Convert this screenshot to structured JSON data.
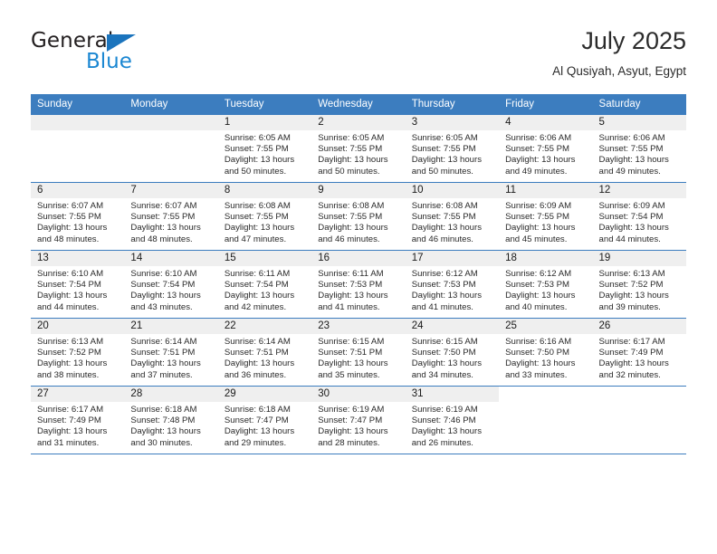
{
  "brand": {
    "name_top": "General",
    "name_bottom": "Blue",
    "triangle_color": "#1b74bd",
    "blue_text_color": "#1b87d2"
  },
  "header": {
    "title": "July 2025",
    "subtitle": "Al Qusiyah, Asyut, Egypt"
  },
  "theme": {
    "header_bg": "#3c7dbf",
    "header_text": "#ffffff",
    "daynum_band_bg": "#efefef",
    "grid_line": "#3c7dbf",
    "body_text": "#2a2a2a"
  },
  "weekdays": [
    "Sunday",
    "Monday",
    "Tuesday",
    "Wednesday",
    "Thursday",
    "Friday",
    "Saturday"
  ],
  "weeks": [
    [
      {
        "day": "",
        "empty": true,
        "sunrise": "",
        "sunset": "",
        "daylight_line1": "",
        "daylight_line2": ""
      },
      {
        "day": "",
        "empty": true,
        "sunrise": "",
        "sunset": "",
        "daylight_line1": "",
        "daylight_line2": ""
      },
      {
        "day": "1",
        "sunrise": "Sunrise: 6:05 AM",
        "sunset": "Sunset: 7:55 PM",
        "daylight_line1": "Daylight: 13 hours",
        "daylight_line2": "and 50 minutes."
      },
      {
        "day": "2",
        "sunrise": "Sunrise: 6:05 AM",
        "sunset": "Sunset: 7:55 PM",
        "daylight_line1": "Daylight: 13 hours",
        "daylight_line2": "and 50 minutes."
      },
      {
        "day": "3",
        "sunrise": "Sunrise: 6:05 AM",
        "sunset": "Sunset: 7:55 PM",
        "daylight_line1": "Daylight: 13 hours",
        "daylight_line2": "and 50 minutes."
      },
      {
        "day": "4",
        "sunrise": "Sunrise: 6:06 AM",
        "sunset": "Sunset: 7:55 PM",
        "daylight_line1": "Daylight: 13 hours",
        "daylight_line2": "and 49 minutes."
      },
      {
        "day": "5",
        "sunrise": "Sunrise: 6:06 AM",
        "sunset": "Sunset: 7:55 PM",
        "daylight_line1": "Daylight: 13 hours",
        "daylight_line2": "and 49 minutes."
      }
    ],
    [
      {
        "day": "6",
        "sunrise": "Sunrise: 6:07 AM",
        "sunset": "Sunset: 7:55 PM",
        "daylight_line1": "Daylight: 13 hours",
        "daylight_line2": "and 48 minutes."
      },
      {
        "day": "7",
        "sunrise": "Sunrise: 6:07 AM",
        "sunset": "Sunset: 7:55 PM",
        "daylight_line1": "Daylight: 13 hours",
        "daylight_line2": "and 48 minutes."
      },
      {
        "day": "8",
        "sunrise": "Sunrise: 6:08 AM",
        "sunset": "Sunset: 7:55 PM",
        "daylight_line1": "Daylight: 13 hours",
        "daylight_line2": "and 47 minutes."
      },
      {
        "day": "9",
        "sunrise": "Sunrise: 6:08 AM",
        "sunset": "Sunset: 7:55 PM",
        "daylight_line1": "Daylight: 13 hours",
        "daylight_line2": "and 46 minutes."
      },
      {
        "day": "10",
        "sunrise": "Sunrise: 6:08 AM",
        "sunset": "Sunset: 7:55 PM",
        "daylight_line1": "Daylight: 13 hours",
        "daylight_line2": "and 46 minutes."
      },
      {
        "day": "11",
        "sunrise": "Sunrise: 6:09 AM",
        "sunset": "Sunset: 7:55 PM",
        "daylight_line1": "Daylight: 13 hours",
        "daylight_line2": "and 45 minutes."
      },
      {
        "day": "12",
        "sunrise": "Sunrise: 6:09 AM",
        "sunset": "Sunset: 7:54 PM",
        "daylight_line1": "Daylight: 13 hours",
        "daylight_line2": "and 44 minutes."
      }
    ],
    [
      {
        "day": "13",
        "sunrise": "Sunrise: 6:10 AM",
        "sunset": "Sunset: 7:54 PM",
        "daylight_line1": "Daylight: 13 hours",
        "daylight_line2": "and 44 minutes."
      },
      {
        "day": "14",
        "sunrise": "Sunrise: 6:10 AM",
        "sunset": "Sunset: 7:54 PM",
        "daylight_line1": "Daylight: 13 hours",
        "daylight_line2": "and 43 minutes."
      },
      {
        "day": "15",
        "sunrise": "Sunrise: 6:11 AM",
        "sunset": "Sunset: 7:54 PM",
        "daylight_line1": "Daylight: 13 hours",
        "daylight_line2": "and 42 minutes."
      },
      {
        "day": "16",
        "sunrise": "Sunrise: 6:11 AM",
        "sunset": "Sunset: 7:53 PM",
        "daylight_line1": "Daylight: 13 hours",
        "daylight_line2": "and 41 minutes."
      },
      {
        "day": "17",
        "sunrise": "Sunrise: 6:12 AM",
        "sunset": "Sunset: 7:53 PM",
        "daylight_line1": "Daylight: 13 hours",
        "daylight_line2": "and 41 minutes."
      },
      {
        "day": "18",
        "sunrise": "Sunrise: 6:12 AM",
        "sunset": "Sunset: 7:53 PM",
        "daylight_line1": "Daylight: 13 hours",
        "daylight_line2": "and 40 minutes."
      },
      {
        "day": "19",
        "sunrise": "Sunrise: 6:13 AM",
        "sunset": "Sunset: 7:52 PM",
        "daylight_line1": "Daylight: 13 hours",
        "daylight_line2": "and 39 minutes."
      }
    ],
    [
      {
        "day": "20",
        "sunrise": "Sunrise: 6:13 AM",
        "sunset": "Sunset: 7:52 PM",
        "daylight_line1": "Daylight: 13 hours",
        "daylight_line2": "and 38 minutes."
      },
      {
        "day": "21",
        "sunrise": "Sunrise: 6:14 AM",
        "sunset": "Sunset: 7:51 PM",
        "daylight_line1": "Daylight: 13 hours",
        "daylight_line2": "and 37 minutes."
      },
      {
        "day": "22",
        "sunrise": "Sunrise: 6:14 AM",
        "sunset": "Sunset: 7:51 PM",
        "daylight_line1": "Daylight: 13 hours",
        "daylight_line2": "and 36 minutes."
      },
      {
        "day": "23",
        "sunrise": "Sunrise: 6:15 AM",
        "sunset": "Sunset: 7:51 PM",
        "daylight_line1": "Daylight: 13 hours",
        "daylight_line2": "and 35 minutes."
      },
      {
        "day": "24",
        "sunrise": "Sunrise: 6:15 AM",
        "sunset": "Sunset: 7:50 PM",
        "daylight_line1": "Daylight: 13 hours",
        "daylight_line2": "and 34 minutes."
      },
      {
        "day": "25",
        "sunrise": "Sunrise: 6:16 AM",
        "sunset": "Sunset: 7:50 PM",
        "daylight_line1": "Daylight: 13 hours",
        "daylight_line2": "and 33 minutes."
      },
      {
        "day": "26",
        "sunrise": "Sunrise: 6:17 AM",
        "sunset": "Sunset: 7:49 PM",
        "daylight_line1": "Daylight: 13 hours",
        "daylight_line2": "and 32 minutes."
      }
    ],
    [
      {
        "day": "27",
        "sunrise": "Sunrise: 6:17 AM",
        "sunset": "Sunset: 7:49 PM",
        "daylight_line1": "Daylight: 13 hours",
        "daylight_line2": "and 31 minutes."
      },
      {
        "day": "28",
        "sunrise": "Sunrise: 6:18 AM",
        "sunset": "Sunset: 7:48 PM",
        "daylight_line1": "Daylight: 13 hours",
        "daylight_line2": "and 30 minutes."
      },
      {
        "day": "29",
        "sunrise": "Sunrise: 6:18 AM",
        "sunset": "Sunset: 7:47 PM",
        "daylight_line1": "Daylight: 13 hours",
        "daylight_line2": "and 29 minutes."
      },
      {
        "day": "30",
        "sunrise": "Sunrise: 6:19 AM",
        "sunset": "Sunset: 7:47 PM",
        "daylight_line1": "Daylight: 13 hours",
        "daylight_line2": "and 28 minutes."
      },
      {
        "day": "31",
        "sunrise": "Sunrise: 6:19 AM",
        "sunset": "Sunset: 7:46 PM",
        "daylight_line1": "Daylight: 13 hours",
        "daylight_line2": "and 26 minutes."
      },
      {
        "day": "",
        "blank": true,
        "sunrise": "",
        "sunset": "",
        "daylight_line1": "",
        "daylight_line2": ""
      },
      {
        "day": "",
        "blank": true,
        "sunrise": "",
        "sunset": "",
        "daylight_line1": "",
        "daylight_line2": ""
      }
    ]
  ]
}
